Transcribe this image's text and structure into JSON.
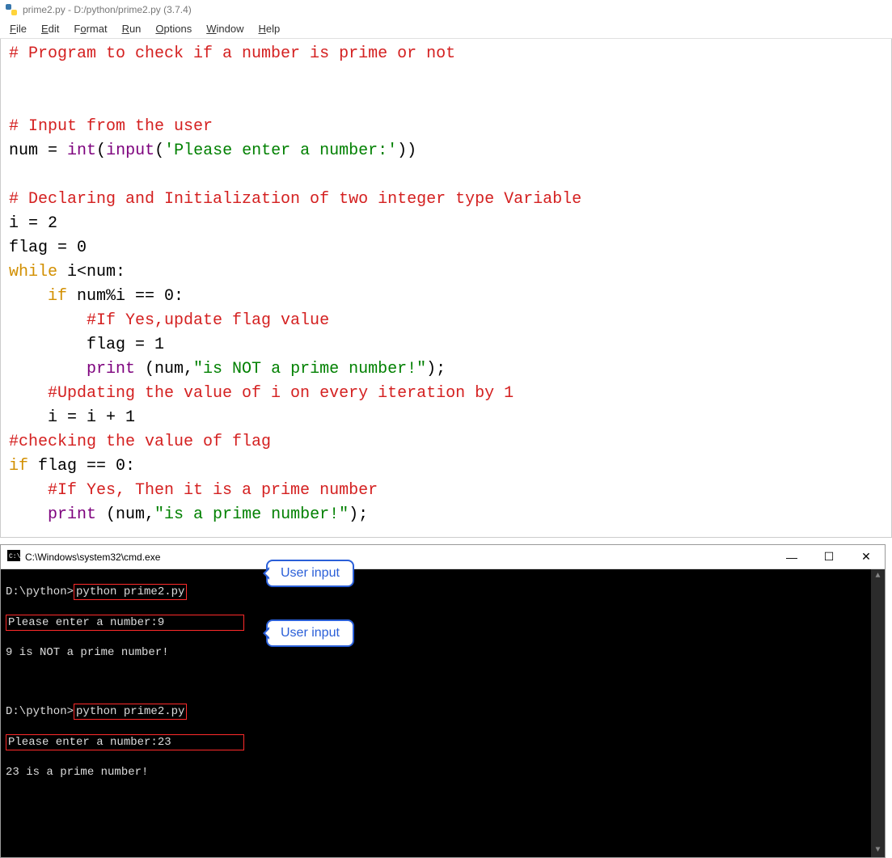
{
  "window": {
    "title": "prime2.py - D:/python/prime2.py (3.7.4)"
  },
  "menu": {
    "file": "File",
    "edit": "Edit",
    "format": "Format",
    "run": "Run",
    "options": "Options",
    "window": "Window",
    "help": "Help"
  },
  "code": {
    "l1": "# Program to check if a number is prime or not",
    "l2": "",
    "l3": "",
    "l4": "# Input from the user",
    "l5a": "num ",
    "l5b": "= ",
    "l5c": "int",
    "l5d": "(",
    "l5e": "input",
    "l5f": "(",
    "l5g": "'Please enter a number:'",
    "l5h": "))",
    "l6": "",
    "l7": "# Declaring and Initialization of two integer type Variable",
    "l8": "i = 2",
    "l9": "flag = 0",
    "l10a": "while",
    "l10b": " i<num:",
    "l11a": "    ",
    "l11b": "if",
    "l11c": " num%i == 0:",
    "l12": "        #If Yes,update flag value",
    "l13": "        flag = 1",
    "l14a": "        ",
    "l14b": "print",
    "l14c": " (num,",
    "l14d": "\"is NOT a prime number!\"",
    "l14e": ");",
    "l15": "    #Updating the value of i on every iteration by 1",
    "l16": "    i = i + 1",
    "l17": "#checking the value of flag",
    "l18a": "if",
    "l18b": " flag == 0:",
    "l19": "    #If Yes, Then it is a prime number",
    "l20a": "    ",
    "l20b": "print",
    "l20c": " (num,",
    "l20d": "\"is a prime number!\"",
    "l20e": ");"
  },
  "console": {
    "title": "C:\\Windows\\system32\\cmd.exe",
    "min": "—",
    "max": "☐",
    "close": "✕",
    "run1": {
      "prompt": "D:\\python>",
      "cmd": "python prime2.py",
      "input_line": "Please enter a number:9",
      "output": "9 is NOT a prime number!"
    },
    "run2": {
      "prompt": "D:\\python>",
      "cmd": "python prime2.py",
      "input_line": "Please enter a number:23",
      "output": "23 is a prime number!"
    },
    "callout1": "User input",
    "callout2": "User input"
  }
}
